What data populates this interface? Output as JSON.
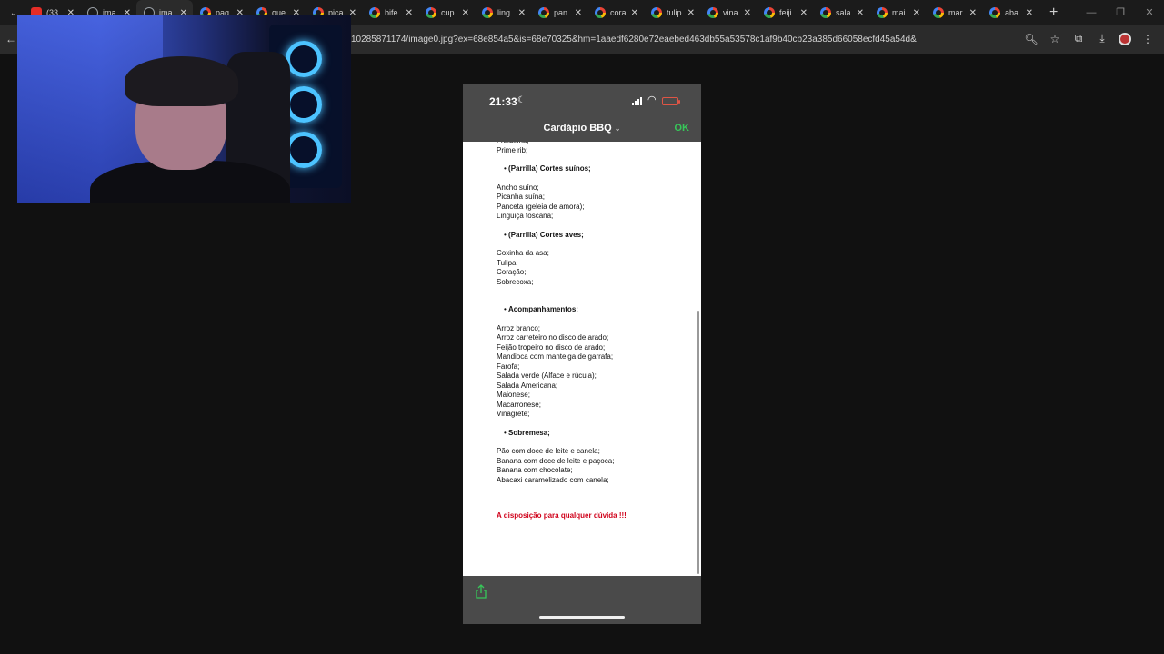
{
  "browser": {
    "tabs": [
      {
        "label": "(33",
        "icon": "youtube-icon"
      },
      {
        "label": "ima",
        "icon": "globe-icon"
      },
      {
        "label": "ima",
        "icon": "globe-icon",
        "active": true
      },
      {
        "label": "pag",
        "icon": "google-icon"
      },
      {
        "label": "que",
        "icon": "google-icon"
      },
      {
        "label": "pica",
        "icon": "google-icon"
      },
      {
        "label": "bife",
        "icon": "google-icon"
      },
      {
        "label": "cup",
        "icon": "google-icon"
      },
      {
        "label": "ling",
        "icon": "google-icon"
      },
      {
        "label": "pan",
        "icon": "google-icon"
      },
      {
        "label": "cora",
        "icon": "google-icon"
      },
      {
        "label": "tulip",
        "icon": "google-icon"
      },
      {
        "label": "vina",
        "icon": "google-icon"
      },
      {
        "label": "feiji",
        "icon": "google-icon"
      },
      {
        "label": "sala",
        "icon": "google-icon"
      },
      {
        "label": "mai",
        "icon": "google-icon"
      },
      {
        "label": "mar",
        "icon": "google-icon"
      },
      {
        "label": "aba",
        "icon": "google-icon"
      }
    ],
    "url": "10285871174/image0.jpg?ex=68e854a5&is=68e70325&hm=1aaedf6280e72eaebed463db55a53578c1af9b40cb23a385d66058ecfd45a54d&"
  },
  "phone": {
    "time": "21:33",
    "doc_title": "Cardápio BBQ",
    "ok_label": "OK",
    "content": {
      "top_lines": [
        "Fraldinha;",
        "Prime rib;"
      ],
      "sections": [
        {
          "title": "(Parrilla) Cortes suínos;",
          "items": [
            "Ancho suíno;",
            "Picanha suína;",
            "Panceta (geleia de amora);",
            "Linguiça toscana;"
          ]
        },
        {
          "title": "(Parrilla) Cortes aves;",
          "items": [
            "Coxinha da asa;",
            "Tulipa;",
            "Coração;",
            "Sobrecoxa;"
          ]
        },
        {
          "title": "Acompanhamentos:",
          "items": [
            "Arroz branco;",
            "Arroz carreteiro no disco de arado;",
            "Feijão tropeiro no disco de arado;",
            "Mandioca com manteiga de garrafa;",
            "Farofa;",
            "Salada verde (Alface e rúcula);",
            "Salada Americana;",
            "Maionese;",
            "Macarronese;",
            "Vinagrete;"
          ]
        },
        {
          "title": "Sobremesa;",
          "items": [
            "Pão com doce de leite e canela;",
            "Banana com doce de leite e paçoca;",
            "Banana com chocolate;",
            "Abacaxi caramelizado com canela;"
          ]
        }
      ],
      "footer_note": "A disposição para qualquer dúvida !!!"
    }
  }
}
